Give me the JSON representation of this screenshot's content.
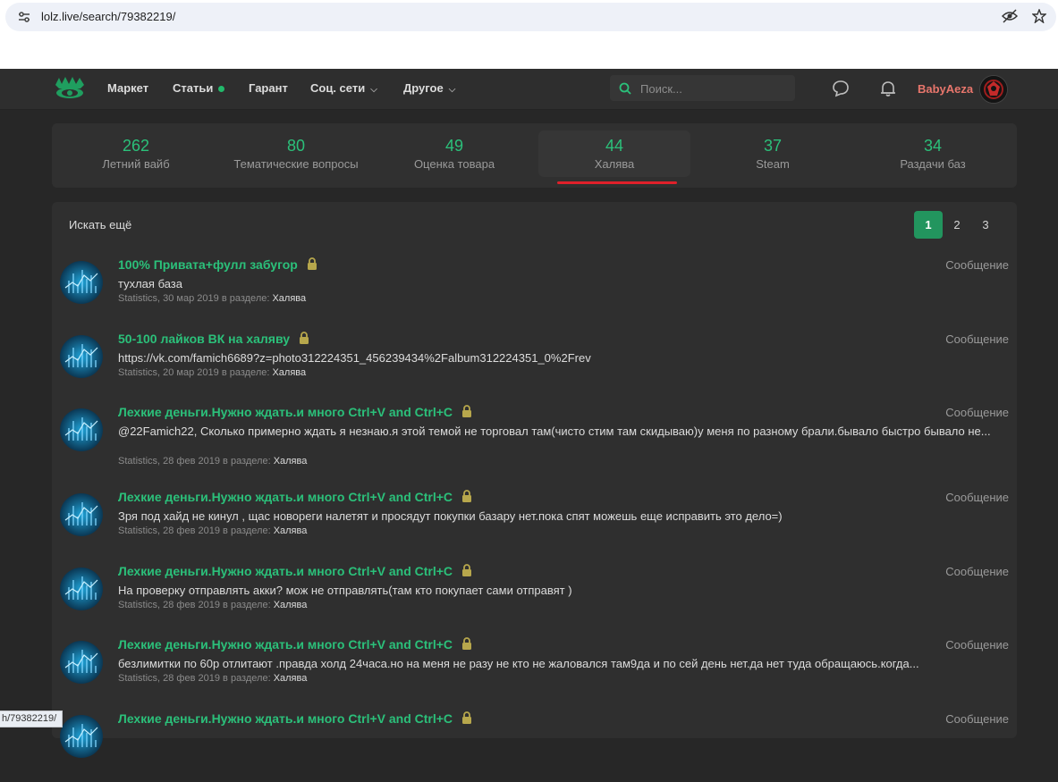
{
  "browser": {
    "url": "lolz.live/search/79382219/",
    "status_url": "h/79382219/"
  },
  "header": {
    "nav": [
      {
        "label": "Маркет"
      },
      {
        "label": "Статьи"
      },
      {
        "label": "Гарант"
      },
      {
        "label": "Соц. сети"
      },
      {
        "label": "Другое"
      }
    ],
    "search_placeholder": "Поиск...",
    "username": "BabyAeza",
    "colors": {
      "accent": "#2bc07a",
      "username": "#e8766c",
      "tab_underline": "#e0202a"
    }
  },
  "tabs": [
    {
      "count": "262",
      "label": "Летний вайб"
    },
    {
      "count": "80",
      "label": "Тематические вопросы"
    },
    {
      "count": "49",
      "label": "Оценка товара"
    },
    {
      "count": "44",
      "label": "Халява"
    },
    {
      "count": "37",
      "label": "Steam"
    },
    {
      "count": "34",
      "label": "Раздачи баз"
    }
  ],
  "results_panel": {
    "search_more": "Искать ещё",
    "pages": [
      "1",
      "2",
      "3"
    ],
    "current_page": "1"
  },
  "results": [
    {
      "title": "100% Привата+фулл забугор",
      "snippet": "тухлая база",
      "author": "Statistics",
      "date": "30 мар 2019",
      "in_section": "в разделе:",
      "section": "Халява",
      "type": "Сообщение"
    },
    {
      "title": "50-100 лайков ВК на халяву",
      "snippet": "https://vk.com/famich6689?z=photo312224351_456239434%2Falbum312224351_0%2Frev",
      "author": "Statistics",
      "date": "20 мар 2019",
      "in_section": "в разделе:",
      "section": "Халява",
      "type": "Сообщение"
    },
    {
      "title": "Лехкие деньги.Нужно ждать.и много Ctrl+V and Ctrl+C",
      "snippet": "@22Famich22, Сколько примерно ждать я незнаю.я этой темой не торговал там(чисто стим там скидываю)у меня по разному брали.бывало быстро бывало не...",
      "author": "Statistics",
      "date": "28 фев 2019",
      "in_section": "в разделе:",
      "section": "Халява",
      "type": "Сообщение"
    },
    {
      "title": "Лехкие деньги.Нужно ждать.и много Ctrl+V and Ctrl+C",
      "snippet": "Зря под хайд не кинул , щас новореги налетят и просядут покупки базару нет.пока спят можешь еще исправить это дело=)",
      "author": "Statistics",
      "date": "28 фев 2019",
      "in_section": "в разделе:",
      "section": "Халява",
      "type": "Сообщение"
    },
    {
      "title": "Лехкие деньги.Нужно ждать.и много Ctrl+V and Ctrl+C",
      "snippet": "На проверку отправлять акки? мож не отправлять(там кто покупает сами отправят )",
      "author": "Statistics",
      "date": "28 фев 2019",
      "in_section": "в разделе:",
      "section": "Халява",
      "type": "Сообщение"
    },
    {
      "title": "Лехкие деньги.Нужно ждать.и много Ctrl+V and Ctrl+C",
      "snippet": "безлимитки по 60р отлитают .правда холд 24часа.но на меня не разу не кто не жаловался там9да и по сей день нет.да нет туда обращаюсь.когда...",
      "author": "Statistics",
      "date": "28 фев 2019",
      "in_section": "в разделе:",
      "section": "Халява",
      "type": "Сообщение"
    },
    {
      "title": "Лехкие деньги.Нужно ждать.и много Ctrl+V and Ctrl+C",
      "snippet": "",
      "author": "",
      "date": "",
      "in_section": "",
      "section": "",
      "type": "Сообщение"
    }
  ]
}
